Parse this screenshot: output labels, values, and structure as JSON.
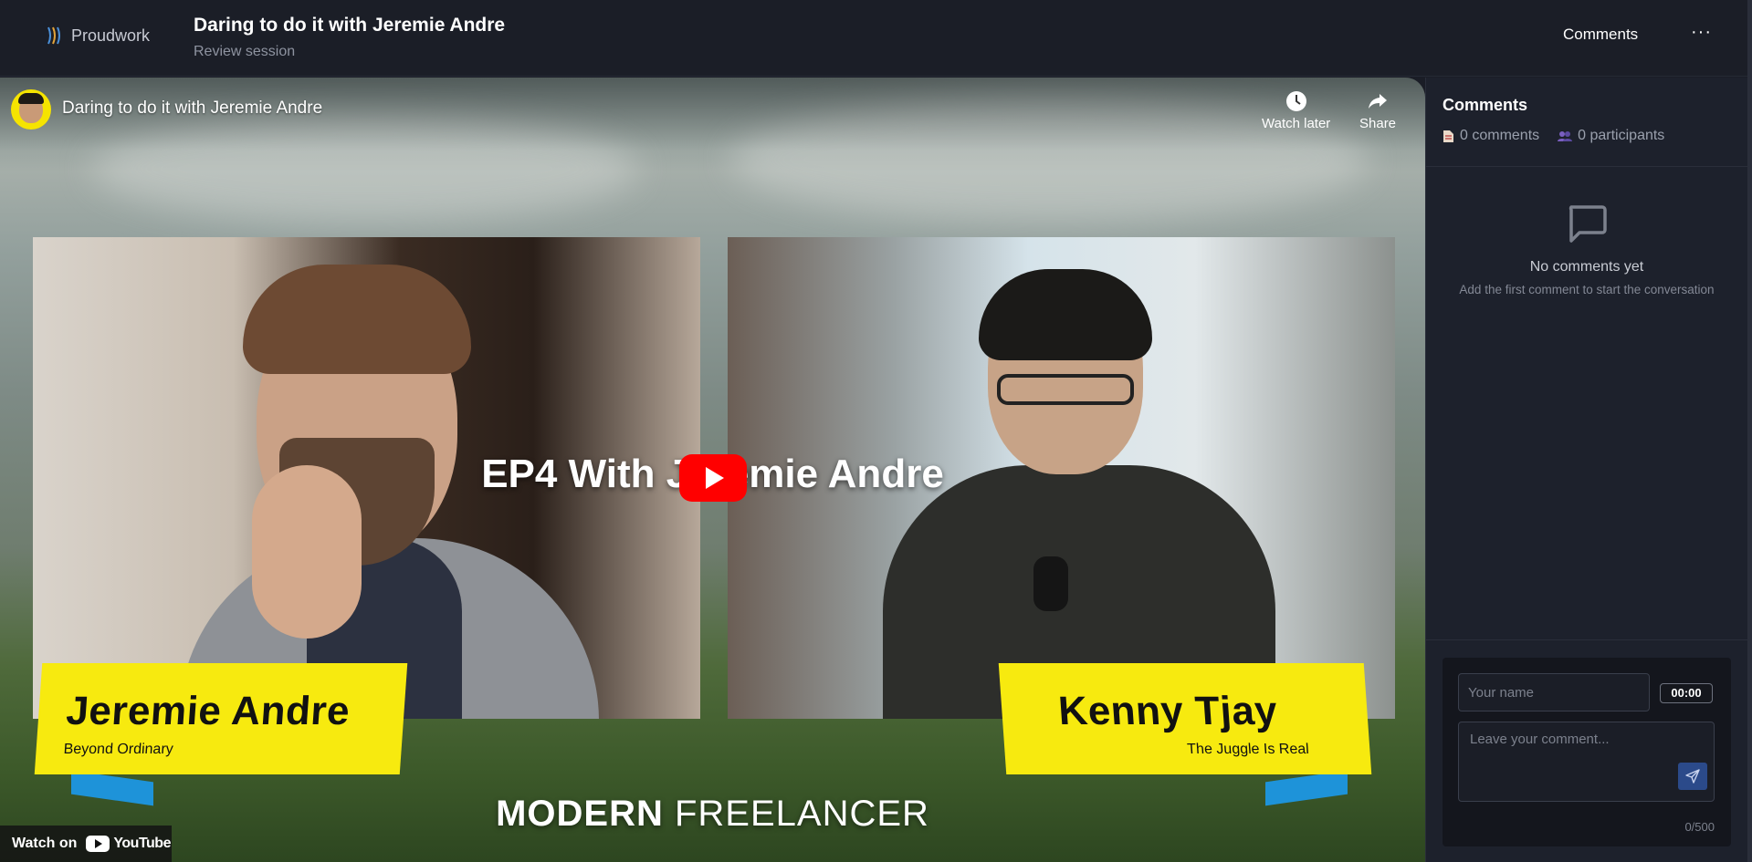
{
  "header": {
    "brand": "Proudwork",
    "title": "Daring to do it with Jeremie Andre",
    "subtitle": "Review session",
    "comments_label": "Comments",
    "more_label": "···"
  },
  "video": {
    "title": "Daring to do it with Jeremie Andre",
    "watch_later": "Watch later",
    "share": "Share",
    "episode_title": "EP4 With Jeremie Andre",
    "left_name": "Jeremie Andre",
    "left_tagline": "Beyond Ordinary",
    "right_name": "Kenny Tjay",
    "right_tagline": "The Juggle Is Real",
    "show_bold": "MODERN",
    "show_light": "FREELANCER",
    "watch_on": "Watch on",
    "youtube": "YouTube"
  },
  "sidebar": {
    "title": "Comments",
    "comments_count": "0 comments",
    "participants_count": "0 participants",
    "empty_title": "No comments yet",
    "empty_sub": "Add the first comment to start the conversation",
    "name_placeholder": "Your name",
    "timestamp": "00:00",
    "comment_placeholder": "Leave your comment...",
    "char_counter": "0/500"
  },
  "colors": {
    "accent_blue": "#2b4a8a",
    "youtube_red": "#ff0000",
    "nameplate_yellow": "#f7ea0f"
  }
}
